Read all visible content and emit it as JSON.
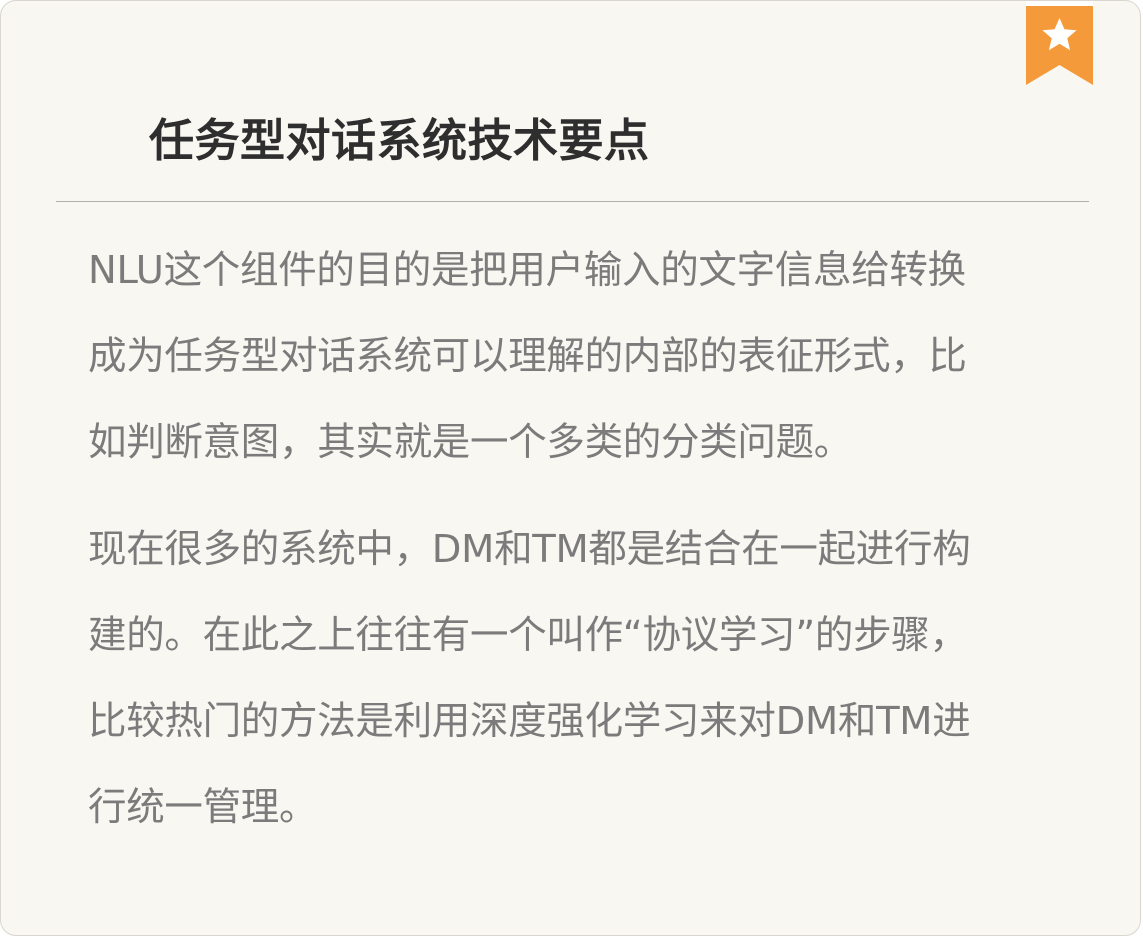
{
  "header": {
    "title": "任务型对话系统技术要点"
  },
  "badge": {
    "icon": "star-icon",
    "color": "#f59a3a"
  },
  "paragraphs": [
    {
      "lines": [
        "NLU这个组件的目的是把用户输入的文字信息给转换",
        "成为任务型对话系统可以理解的内部的表征形式，比",
        "如判断意图，其实就是一个多类的分类问题。"
      ]
    },
    {
      "lines": [
        "现在很多的系统中，DM和TM都是结合在一起进行构",
        "建的。在此之上往往有一个叫作“协议学习”的步骤，",
        "比较热门的方法是利用深度强化学习来对DM和TM进",
        "行统一管理。"
      ]
    }
  ]
}
